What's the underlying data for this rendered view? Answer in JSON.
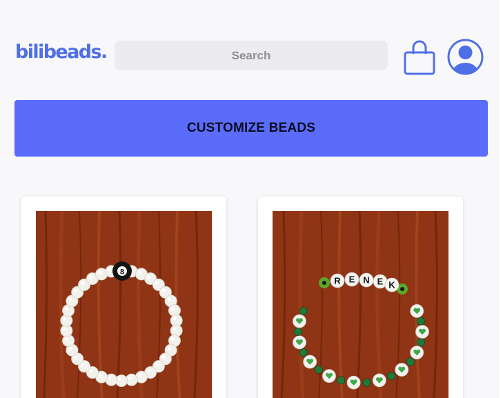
{
  "header": {
    "logo_text": "bilibeads.",
    "search_placeholder": "Search",
    "cart_icon": "shopping-bag-icon",
    "account_icon": "user-avatar-icon"
  },
  "cta": {
    "label": "CUSTOMIZE BEADS"
  },
  "products": [
    {
      "image": "white bead bracelet with black 8-ball bead",
      "bead_label": "8"
    },
    {
      "image": "green heart bead name bracelet",
      "bead_letters": [
        "R",
        "E",
        "N",
        "E",
        "K"
      ]
    }
  ],
  "colors": {
    "brand": "#4f6fe6",
    "cta_background": "#5b6cfb",
    "search_background": "#ececf0"
  }
}
